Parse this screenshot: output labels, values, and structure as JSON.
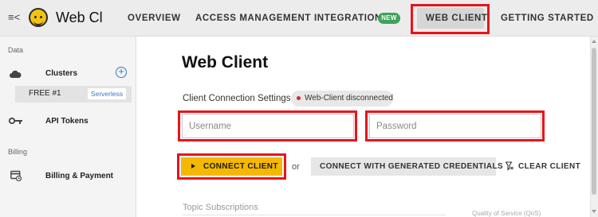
{
  "header": {
    "menu_icon": "collapse-menu-icon",
    "logo_icon": "bee-logo-icon",
    "brand": "Web Cli",
    "nav": {
      "overview": "OVERVIEW",
      "access_management": "ACCESS MANAGEMENT",
      "integrations": "INTEGRATIONS",
      "integrations_badge": "NEW",
      "web_client": "WEB CLIENT",
      "getting_started": "GETTING STARTED"
    },
    "active_tab": "WEB CLIENT"
  },
  "sidebar": {
    "data_section": "Data",
    "clusters_label": "Clusters",
    "clusters_icon": "cloud-icon",
    "add_cluster_icon": "plus-circle-icon",
    "cluster_item": {
      "name": "FREE #1",
      "badge": "Serverless"
    },
    "api_tokens_label": "API Tokens",
    "api_tokens_icon": "key-icon",
    "billing_section": "Billing",
    "billing_label": "Billing & Payment",
    "billing_icon": "billing-icon"
  },
  "main": {
    "title": "Web Client",
    "connection_settings_label": "Client Connection Settings",
    "status": "Web-Client disconnected",
    "status_color": "#d8282f",
    "username_placeholder": "Username",
    "password_placeholder": "Password",
    "connect_label": "CONNECT CLIENT",
    "connect_icon": "play-icon",
    "or_text": "or",
    "generated_label": "CONNECT WITH GENERATED CREDENTIALS",
    "clear_label": "CLEAR CLIENT",
    "clear_icon": "clear-filter-icon",
    "topic_subscriptions_label": "Topic Subscriptions",
    "qos_label": "Quality of Service (QoS)"
  },
  "colors": {
    "accent_yellow": "#f5b800",
    "highlight_red": "#e8141b",
    "new_badge_green": "#3ea35a",
    "link_blue": "#3a78c2"
  }
}
